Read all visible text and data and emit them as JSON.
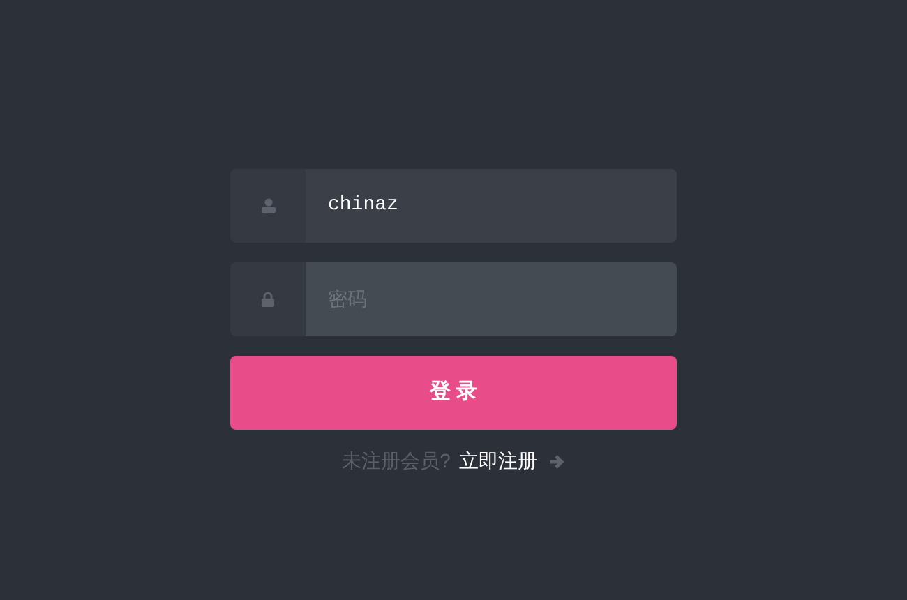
{
  "fields": [
    {
      "kind": "user",
      "value": "chinaz"
    },
    {
      "kind": "password",
      "placeholder": "密码"
    }
  ],
  "submit": "登 录",
  "footer": {
    "prompt": "未注册会员?",
    "link": "立即注册"
  }
}
